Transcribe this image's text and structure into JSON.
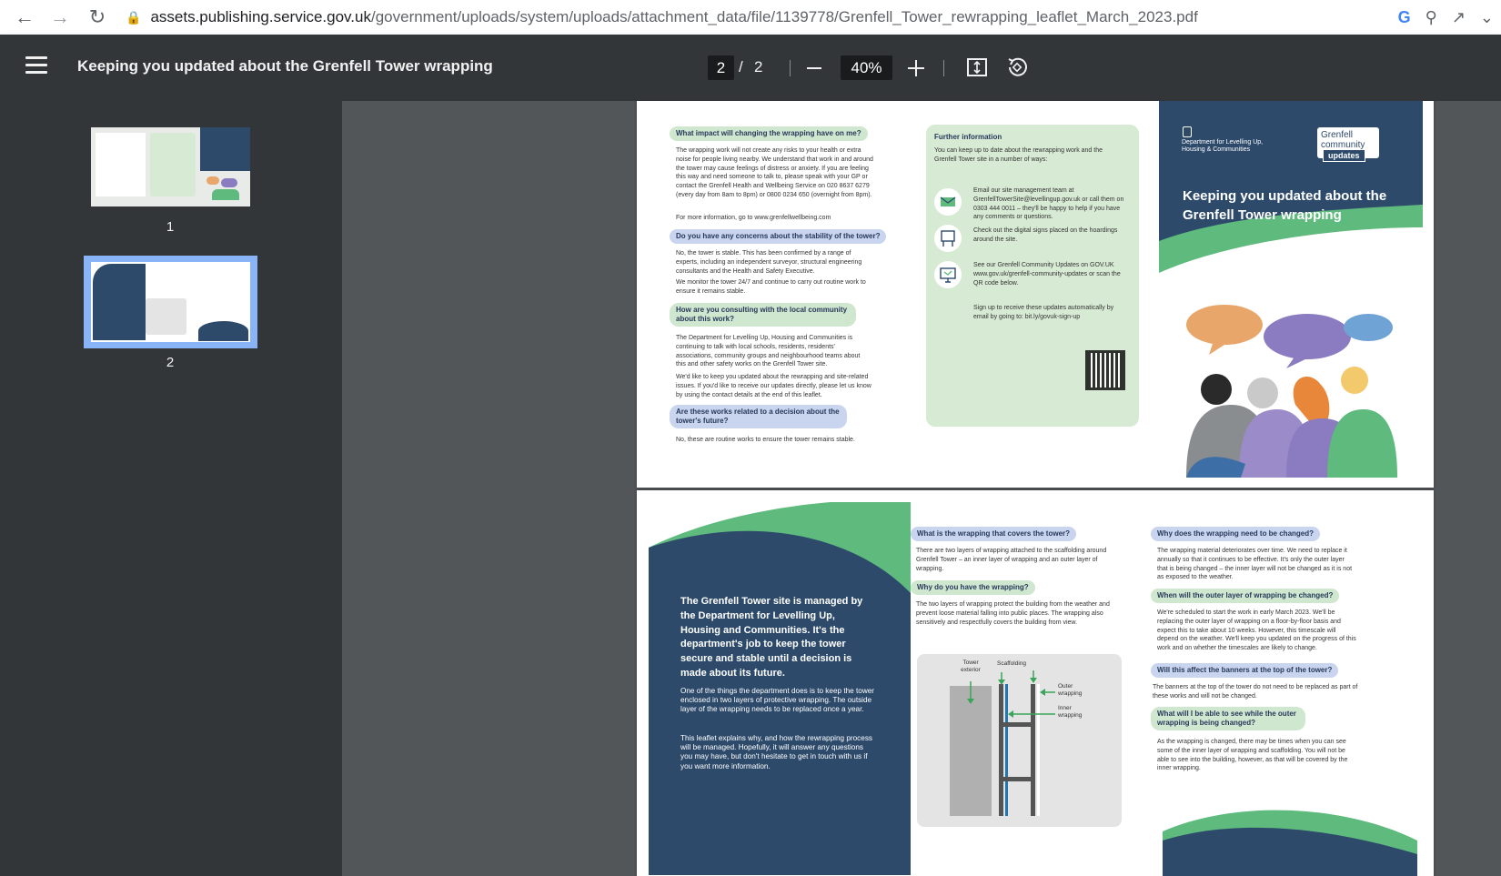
{
  "browser": {
    "url_host": "assets.publishing.service.gov.uk",
    "url_path": "/government/uploads/system/uploads/attachment_data/file/1139778/Grenfell_Tower_rewrapping_leaflet_March_2023.pdf"
  },
  "toolbar": {
    "title": "Keeping you updated about the Grenfell Tower wrapping",
    "current_page": "2",
    "page_separator": "/",
    "total_pages": "2",
    "zoom": "40%"
  },
  "sidebar": {
    "thumbnails": [
      {
        "label": "1"
      },
      {
        "label": "2"
      }
    ]
  },
  "page1": {
    "q1": "What impact will changing the wrapping have on me?",
    "a1": "The wrapping work will not create any risks to your health or extra noise for people living nearby. We understand that work in and around the tower may cause feelings of distress or anxiety. If you are feeling this way and need someone to talk to, please speak with your GP or contact the Grenfell Health and Wellbeing Service on 020 8637 6279 (every day from 8am to 8pm) or 0800 0234 650 (overnight from 8pm).",
    "a1b": "For more information, go to www.grenfellwellbeing.com",
    "q2": "Do you have any concerns about the stability of the tower?",
    "a2": "No, the tower is stable. This has been confirmed by a range of experts, including an independent surveyor, structural engineering consultants and the Health and Safety Executive.",
    "a2b": "We monitor the tower 24/7 and continue to carry out routine work to ensure it remains stable.",
    "q3": "How are you consulting with the local community about this work?",
    "a3": "The Department for Levelling Up, Housing and Communities is continuing to talk with local schools, residents, residents' associations, community groups and neighbourhood teams about this and other safety works on the Grenfell Tower site.",
    "a3b": "We'd like to keep you updated about the rewrapping and site-related issues. If you'd like to receive our updates directly, please let us know by using the contact details at the end of this leaflet.",
    "q4": "Are these works related to a decision about the tower's future?",
    "a4": "No, these are routine works to ensure the tower remains stable.",
    "info_title": "Further information",
    "info_intro": "You can keep up to date about the rewrapping work and the Grenfell Tower site in a number of ways:",
    "info_email": "Email our site management team at GrenfellTowerSite@levellingup.gov.uk or call them on 0303 444 0011 – they'll be happy to help if you have any comments or questions.",
    "info_signs": "Check out the digital signs placed on the hoardings around the site.",
    "info_govuk": "See our Grenfell Community Updates on GOV.UK www.gov.uk/grenfell-community-updates or scan the QR code below.",
    "info_signup": "Sign up to receive these updates automatically by email by going to: bit.ly/govuk-sign-up",
    "dept_name": "Department for Levelling Up, Housing & Communities",
    "badge_line1": "Grenfell",
    "badge_line2": "community",
    "badge_line3": "updates",
    "cover_title": "Keeping you updated about the Grenfell Tower wrapping"
  },
  "page2": {
    "panel_heading": "The Grenfell Tower site is managed by the Department for Levelling Up, Housing and Communities. It's the department's job to keep the tower secure and stable until a decision is made about its future.",
    "panel_p1": "One of the things the department does is to keep the tower enclosed in two layers of protective wrapping. The outside layer of the wrapping needs to be replaced once a year.",
    "panel_p2": "This leaflet explains why, and how the rewrapping process will be managed. Hopefully, it will answer any questions you may have, but don't hesitate to get in touch with us if you want more information.",
    "q1": "What is the wrapping that covers the tower?",
    "a1": "There are two layers of wrapping attached to the scaffolding around Grenfell Tower – an inner layer of wrapping and an outer layer of wrapping.",
    "q2": "Why do you have the wrapping?",
    "a2": "The two layers of wrapping protect the building from the weather and prevent loose material falling into public places. The wrapping also sensitively and respectfully covers the building from view.",
    "diag_tower": "Tower exterior",
    "diag_scaffold": "Scaffolding",
    "diag_outer": "Outer wrapping",
    "diag_inner": "Inner wrapping",
    "q3": "Why does the wrapping need to be changed?",
    "a3": "The wrapping material deteriorates over time. We need to replace it annually so that it continues to be effective. It's only the outer layer that is being changed – the inner layer will not be changed as it is not as exposed to the weather.",
    "q4": "When will the outer layer of wrapping be changed?",
    "a4": "We're scheduled to start the work in early March 2023. We'll be replacing the outer layer of wrapping on a floor-by-floor basis and expect this to take about 10 weeks. However, this timescale will depend on the weather. We'll keep you updated on the progress of this work and on whether the timescales are likely to change.",
    "q5": "Will this affect the banners at the top of the tower?",
    "a5": "The banners at the top of the tower do not need to be replaced as part of these works and will not be changed.",
    "q6": "What will I be able to see while the outer wrapping is being changed?",
    "a6": "As the wrapping is changed, there may be times when you can see some of the inner layer of wrapping and scaffolding. You will not be able to see into the building, however, as that will be covered by the inner wrapping."
  },
  "colors": {
    "navy": "#2d4a6b",
    "green": "#5fba7d",
    "toolbar": "#323639",
    "viewer_bg": "#525659"
  }
}
